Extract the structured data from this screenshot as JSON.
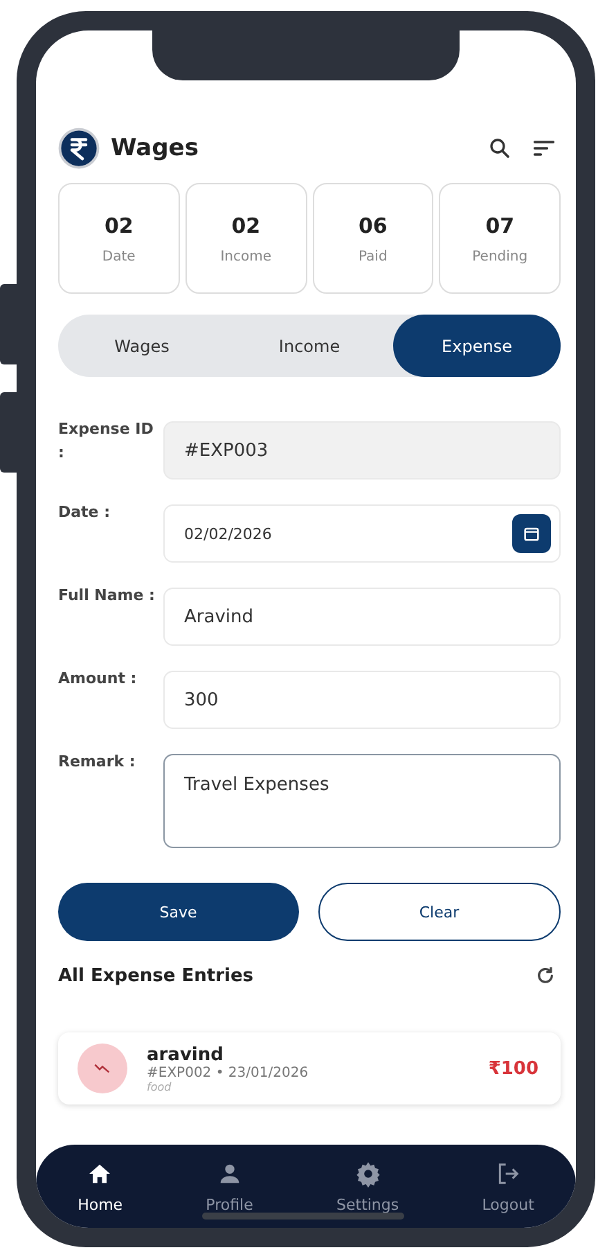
{
  "header": {
    "title": "Wages"
  },
  "stats": [
    {
      "value": "02",
      "label": "Date"
    },
    {
      "value": "02",
      "label": "Income"
    },
    {
      "value": "06",
      "label": "Paid"
    },
    {
      "value": "07",
      "label": "Pending"
    }
  ],
  "tabs": [
    {
      "label": "Wages",
      "selected": false
    },
    {
      "label": "Income",
      "selected": false
    },
    {
      "label": "Expense",
      "selected": true
    }
  ],
  "form": [
    {
      "kind": "readonly",
      "label": "Expense ID :",
      "value": "#EXP003"
    },
    {
      "kind": "date",
      "label": "Date :",
      "value": "02/02/2026"
    },
    {
      "kind": "text",
      "label": "Full Name :",
      "value": "Aravind"
    },
    {
      "kind": "text",
      "label": "Amount :",
      "value": "300"
    },
    {
      "kind": "textarea",
      "label": "Remark :",
      "value": "Travel Expenses"
    }
  ],
  "buttons": [
    {
      "label": "Save",
      "kind": "primary"
    },
    {
      "label": "Clear",
      "kind": "outline"
    }
  ],
  "entries_title": "All Expense Entries",
  "entries": [
    {
      "name": "aravind",
      "meta": "#EXP002 • 23/01/2026",
      "category": "food",
      "amount": "₹100"
    }
  ],
  "nav": [
    {
      "label": "Home",
      "kind": "home",
      "selected": true
    },
    {
      "label": "Profile",
      "kind": "profile",
      "selected": false
    },
    {
      "label": "Settings",
      "kind": "settings",
      "selected": false
    },
    {
      "label": "Logout",
      "kind": "logout",
      "selected": false
    }
  ]
}
